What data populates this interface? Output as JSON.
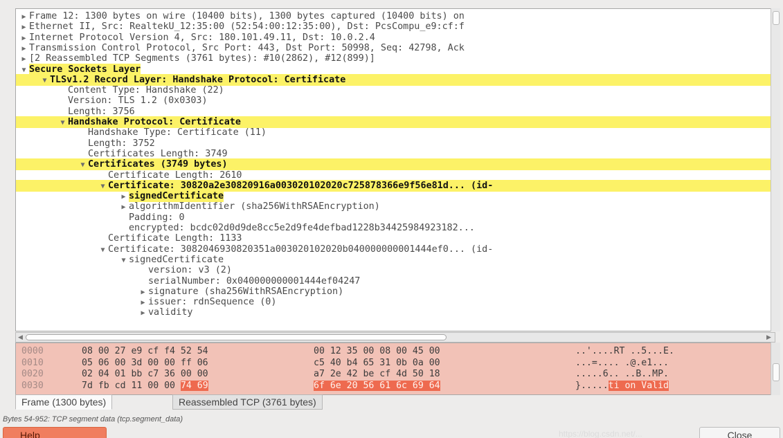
{
  "tree": {
    "rows": [
      {
        "caret": "▶",
        "label": "Frame 12: 1300 bytes on wire (10400 bits), 1300 bytes captured (10400 bits) on",
        "hl": "none"
      },
      {
        "caret": "▶",
        "label": "Ethernet II, Src: RealtekU_12:35:00 (52:54:00:12:35:00), Dst: PcsCompu_e9:cf:f",
        "hl": "none"
      },
      {
        "caret": "▶",
        "label": "Internet Protocol Version 4, Src: 180.101.49.11, Dst: 10.0.2.4",
        "hl": "none"
      },
      {
        "caret": "▶",
        "label": "Transmission Control Protocol, Src Port: 443, Dst Port: 50998, Seq: 42798, Ack",
        "hl": "none"
      },
      {
        "caret": "▶",
        "label": "[2 Reassembled TCP Segments (3761 bytes): #10(2862), #12(899)]",
        "hl": "none"
      },
      {
        "caret": "▼",
        "label": "Secure Sockets Layer",
        "hl": "text"
      },
      {
        "caret": "▼",
        "label": "TLSv1.2 Record Layer: Handshake Protocol: Certificate",
        "hl": "full"
      },
      {
        "caret": "",
        "label": "Content Type: Handshake (22)",
        "hl": "none"
      },
      {
        "caret": "",
        "label": "Version: TLS 1.2 (0x0303)",
        "hl": "none"
      },
      {
        "caret": "",
        "label": "Length: 3756",
        "hl": "none"
      },
      {
        "caret": "▼",
        "label": "Handshake Protocol: Certificate",
        "hl": "full"
      },
      {
        "caret": "",
        "label": "Handshake Type: Certificate (11)",
        "hl": "none"
      },
      {
        "caret": "",
        "label": "Length: 3752",
        "hl": "none"
      },
      {
        "caret": "",
        "label": "Certificates Length: 3749",
        "hl": "none"
      },
      {
        "caret": "▼",
        "label": "Certificates (3749 bytes)",
        "hl": "full"
      },
      {
        "caret": "",
        "label": "Certificate Length: 2610",
        "hl": "none"
      },
      {
        "caret": "▼",
        "label": "Certificate: 30820a2e30820916a003020102020c725878366e9f56e81d... (id-",
        "hl": "full"
      },
      {
        "caret": "▶",
        "label": "signedCertificate",
        "hl": "text"
      },
      {
        "caret": "▶",
        "label": "algorithmIdentifier (sha256WithRSAEncryption)",
        "hl": "none"
      },
      {
        "caret": "",
        "label": "Padding: 0",
        "hl": "none"
      },
      {
        "caret": "",
        "label": "encrypted: bcdc02d0d9de8cc5e2d9fe4defbad1228b34425984923182...",
        "hl": "none"
      },
      {
        "caret": "",
        "label": "Certificate Length: 1133",
        "hl": "none"
      },
      {
        "caret": "▼",
        "label": "Certificate: 3082046930820351a003020102020b040000000001444ef0... (id-",
        "hl": "none"
      },
      {
        "caret": "▼",
        "label": "signedCertificate",
        "hl": "none"
      },
      {
        "caret": "",
        "label": "version: v3 (2)",
        "hl": "none"
      },
      {
        "caret": "",
        "label": "serialNumber: 0x040000000001444ef04247",
        "hl": "none"
      },
      {
        "caret": "▶",
        "label": "signature (sha256WithRSAEncryption)",
        "hl": "none"
      },
      {
        "caret": "▶",
        "label": "issuer: rdnSequence (0)",
        "hl": "none"
      },
      {
        "caret": "▶",
        "label": "validity",
        "hl": "none"
      }
    ]
  },
  "hex": {
    "rows": [
      {
        "offset": "0000",
        "b1": "08 00 27 e9 cf f4 52 54",
        "b2": "00 12 35 00 08 00 45 00",
        "b2_sel": "",
        "ascii": "..'....RT ..5...E.",
        "ascii_sel": ""
      },
      {
        "offset": "0010",
        "b1": "05 06 00 3d 00 00 ff 06",
        "b2": "c5 40 b4 65 31 0b 0a 00",
        "b2_sel": "",
        "ascii": "...=.... .@.e1...",
        "ascii_sel": ""
      },
      {
        "offset": "0020",
        "b1": "02 04 01 bb c7 36 00 00",
        "b2": "a7 2e 42 be cf 4d 50 18",
        "b2_sel": "",
        "ascii": ".....6.. ..B..MP.",
        "ascii_sel": ""
      },
      {
        "offset": "0030",
        "b1": "7d fb cd 11 00 00",
        "b1_sel": "74 69",
        "b2": "",
        "b2_sel": "6f 6e 20 56 61 6c 69 64",
        "ascii": "}.....",
        "ascii_sel": "ti on Valid"
      }
    ]
  },
  "tabs": [
    {
      "label": "Frame (1300 bytes)",
      "active": true
    },
    {
      "label": "Reassembled TCP (3761 bytes)",
      "active": false
    }
  ],
  "status": "Bytes 54-952: TCP segment data (tcp.segment_data)",
  "buttons": {
    "help": "Help",
    "close": "Close"
  },
  "watermark": "https://blog.csdn.net/..."
}
